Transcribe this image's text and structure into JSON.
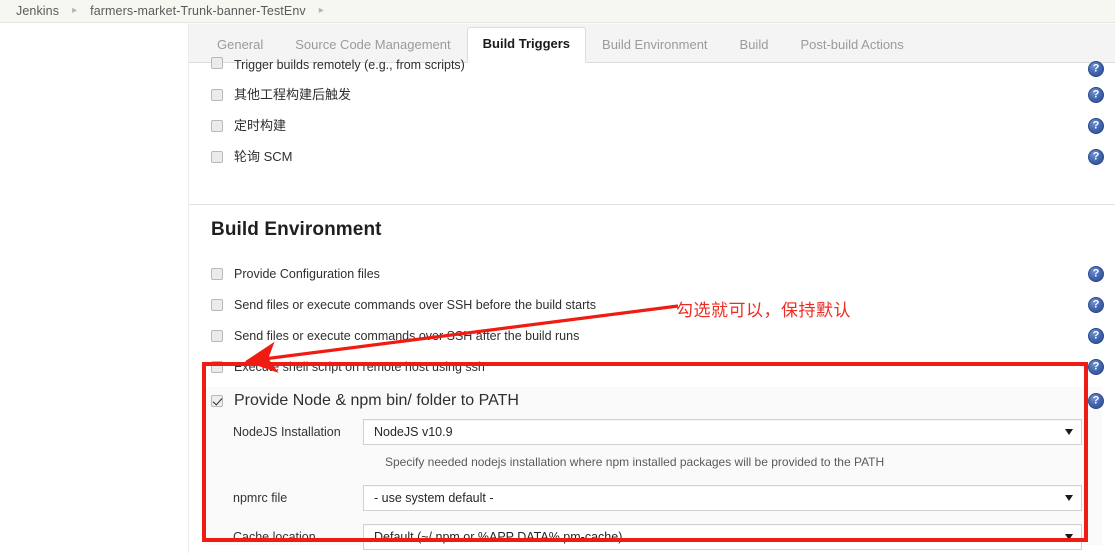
{
  "breadcrumb": {
    "items": [
      "Jenkins",
      "farmers-market-Trunk-banner-TestEnv"
    ],
    "separator": "▸",
    "trailing_separator": "▸"
  },
  "tabs": [
    {
      "label": "General",
      "active": false
    },
    {
      "label": "Source Code Management",
      "active": false
    },
    {
      "label": "Build Triggers",
      "active": true
    },
    {
      "label": "Build Environment",
      "active": false
    },
    {
      "label": "Build",
      "active": false
    },
    {
      "label": "Post-build Actions",
      "active": false
    }
  ],
  "build_triggers": {
    "options": [
      {
        "label": "Trigger builds remotely (e.g., from scripts)",
        "checked": false,
        "clipped": true
      },
      {
        "label": "其他工程构建后触发",
        "checked": false,
        "cjk": true
      },
      {
        "label": "定时构建",
        "checked": false,
        "cjk": true
      },
      {
        "label": "轮询 SCM",
        "checked": false,
        "cjk": true
      }
    ]
  },
  "build_environment": {
    "title": "Build Environment",
    "options": [
      {
        "label": "Provide Configuration files",
        "checked": false
      },
      {
        "label": "Send files or execute commands over SSH before the build starts",
        "checked": false
      },
      {
        "label": "Send files or execute commands over SSH after the build runs",
        "checked": false
      },
      {
        "label": "Execute shell script on remote host using ssh",
        "checked": false
      }
    ],
    "nodejs": {
      "checkbox_label": "Provide Node & npm bin/ folder to PATH",
      "checked": true,
      "fields": [
        {
          "label": "NodeJS Installation",
          "value": "NodeJS  v10.9"
        },
        {
          "label": "npmrc file",
          "value": "- use system default -"
        },
        {
          "label": "Cache location",
          "value": "Default (~/.npm or %APP  DATA% pm-cache)"
        }
      ],
      "hint": "Specify needed nodejs installation where npm installed packages will be provided to the PATH"
    }
  },
  "help_icon_glyph": "?",
  "annotation": {
    "text": "勾选就可以，保持默认",
    "color": "#ee2b20",
    "box_color": "#f01b12"
  }
}
